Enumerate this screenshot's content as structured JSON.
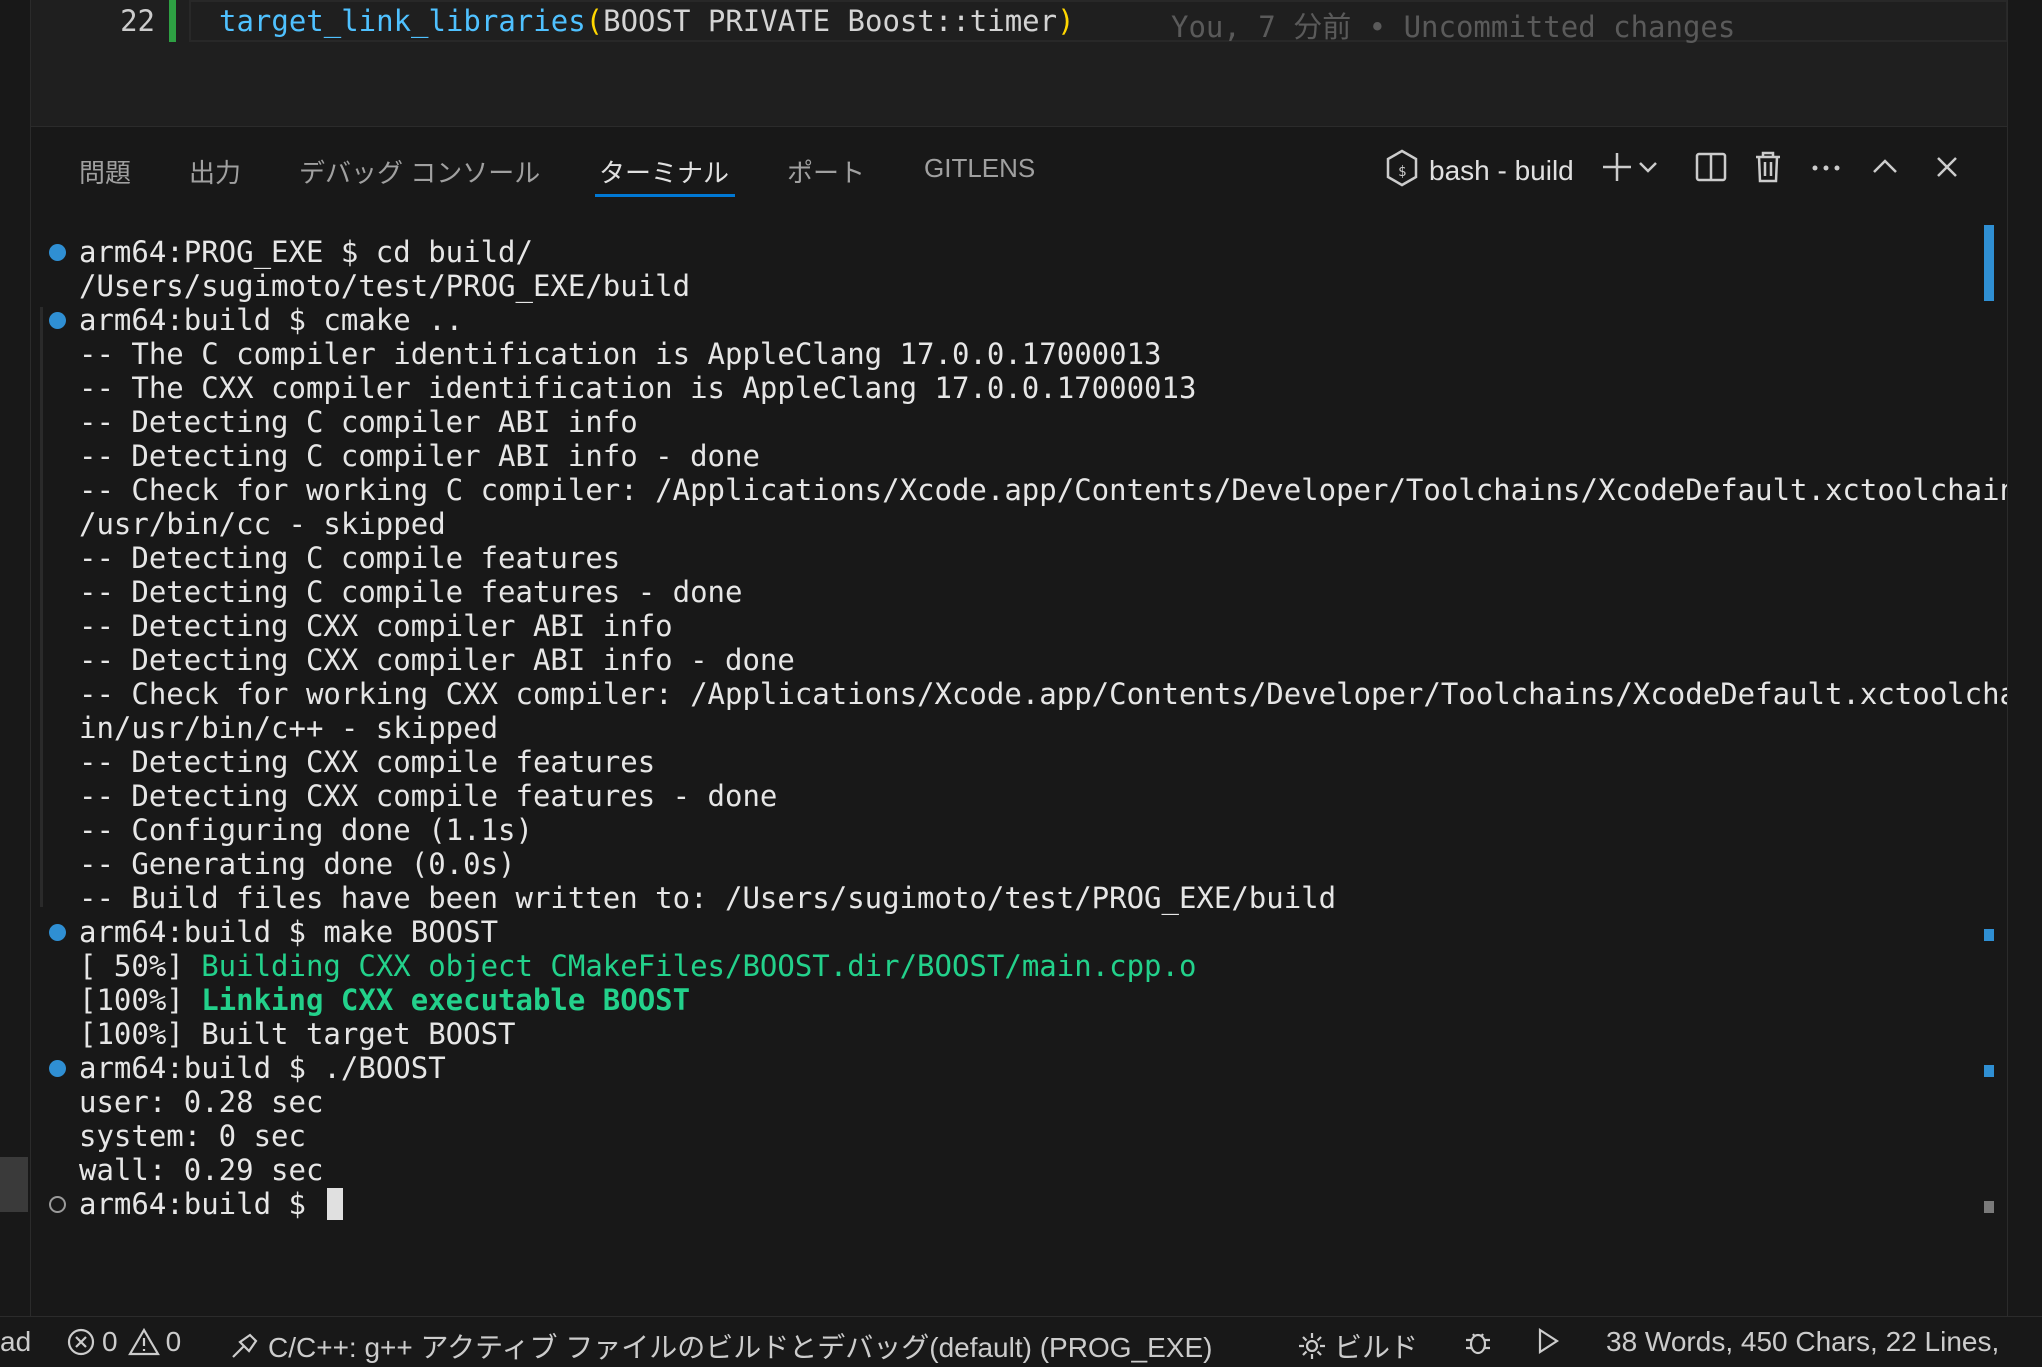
{
  "editor": {
    "line_number": "22",
    "code": {
      "fn": "target_link_libraries",
      "open": "(",
      "args": "BOOST PRIVATE Boost::timer",
      "close": ")"
    },
    "blame": "You, 7 分前 • Uncommitted changes"
  },
  "panel": {
    "tabs": [
      {
        "label": "問題"
      },
      {
        "label": "出力"
      },
      {
        "label": "デバッグ コンソール"
      },
      {
        "label": "ターミナル"
      },
      {
        "label": "ポート"
      },
      {
        "label": "GITLENS"
      }
    ],
    "active_tab": "ターミナル",
    "terminal_name": "bash - build"
  },
  "terminal": {
    "lines": [
      "arm64:PROG_EXE $ cd build/",
      "/Users/sugimoto/test/PROG_EXE/build",
      "arm64:build $ cmake ..",
      "-- The C compiler identification is AppleClang 17.0.0.17000013",
      "-- The CXX compiler identification is AppleClang 17.0.0.17000013",
      "-- Detecting C compiler ABI info",
      "-- Detecting C compiler ABI info - done",
      "-- Check for working C compiler: /Applications/Xcode.app/Contents/Developer/Toolchains/XcodeDefault.xctoolchain",
      "/usr/bin/cc - skipped",
      "-- Detecting C compile features",
      "-- Detecting C compile features - done",
      "-- Detecting CXX compiler ABI info",
      "-- Detecting CXX compiler ABI info - done",
      "-- Check for working CXX compiler: /Applications/Xcode.app/Contents/Developer/Toolchains/XcodeDefault.xctoolcha",
      "in/usr/bin/c++ - skipped",
      "-- Detecting CXX compile features",
      "-- Detecting CXX compile features - done",
      "-- Configuring done (1.1s)",
      "-- Generating done (0.0s)",
      "-- Build files have been written to: /Users/sugimoto/test/PROG_EXE/build",
      "arm64:build $ make BOOST",
      "[ 50%] ",
      "Building CXX object CMakeFiles/BOOST.dir/BOOST/main.cpp.o",
      "[100%] ",
      "Linking CXX executable BOOST",
      "[100%] Built target BOOST",
      "arm64:build $ ./BOOST",
      "user: 0.28 sec",
      "system: 0 sec",
      "wall: 0.29 sec",
      "arm64:build $ "
    ]
  },
  "statusbar": {
    "left_fragment": "ad",
    "errors": "0",
    "warnings": "0",
    "task": "C/C++: g++ アクティブ ファイルのビルドとデバッグ(default) (PROG_EXE)",
    "build_label": "ビルド",
    "stats": "38 Words, 450 Chars, 22 Lines,"
  },
  "colors": {
    "accent": "#0078d4",
    "success_dot": "#2f8fd3",
    "terminal_green": "#23d18b",
    "git_added": "#2ea043"
  },
  "icons": {
    "terminal_profile": "bash-terminal-icon",
    "new_terminal": "plus-icon",
    "launch_profile": "chevron-down-icon",
    "split": "split-terminal-icon",
    "kill": "trash-icon",
    "more": "ellipsis-icon",
    "maximize": "chevron-up-icon",
    "close": "close-icon"
  }
}
